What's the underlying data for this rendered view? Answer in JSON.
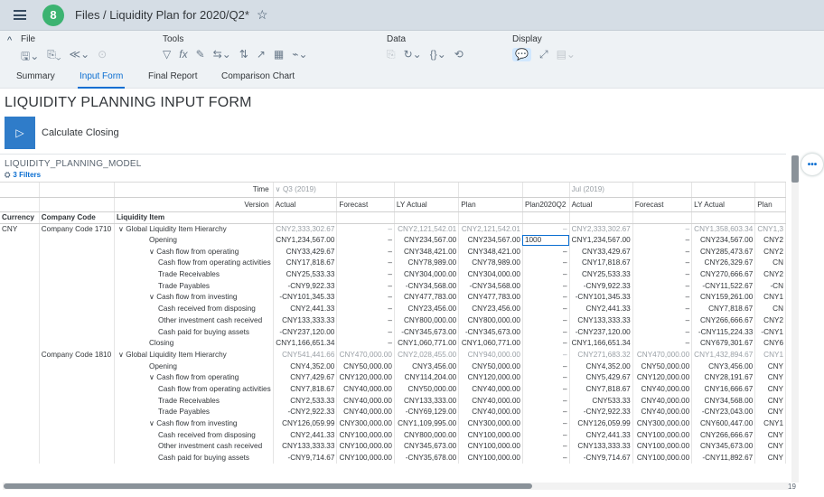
{
  "shell": {
    "logo_letter": "8",
    "breadcrumb": "Files / Liquidity Plan for 2020/Q2*"
  },
  "toolbar": {
    "file": "File",
    "tools": "Tools",
    "data": "Data",
    "display": "Display"
  },
  "tabs": [
    "Summary",
    "Input Form",
    "Final Report",
    "Comparison Chart"
  ],
  "page_title": "LIQUIDITY PLANNING INPUT FORM",
  "run_label": "Calculate Closing",
  "model_name": "LIQUIDITY_PLANNING_MODEL",
  "filters_label": "3 Filters",
  "grid": {
    "time_label": "Time",
    "version_label": "Version",
    "dim_headers": [
      "Currency",
      "Company Code",
      "Liquidity Item"
    ],
    "period1": "∨ Q3 (2019)",
    "period2": "Jul (2019)",
    "versions": [
      "Actual",
      "Forecast",
      "LY Actual",
      "Plan",
      "Plan2020Q2",
      "Actual",
      "Forecast",
      "LY Actual",
      "Plan"
    ],
    "rows": [
      {
        "cur": "CNY",
        "cc": "Company Code 1710",
        "item": "∨ Global Liquidity Item Hierarchy",
        "lvl": 0,
        "gray": true,
        "v": [
          "CNY2,333,302.67",
          "–",
          "CNY2,121,542.01",
          "CNY2,121,542.01",
          "–",
          "CNY2,333,302.67",
          "–",
          "CNY1,358,603.34",
          "CNY1,3"
        ]
      },
      {
        "cur": "",
        "cc": "",
        "item": "Opening",
        "lvl": 1,
        "v": [
          "CNY1,234,567.00",
          "–",
          "CNY234,567.00",
          "CNY234,567.00",
          "1000",
          "CNY1,234,567.00",
          "–",
          "CNY234,567.00",
          "CNY2"
        ]
      },
      {
        "cur": "",
        "cc": "",
        "item": "∨ Cash flow from operating",
        "lvl": 1,
        "v": [
          "CNY33,429.67",
          "–",
          "CNY348,421.00",
          "CNY348,421.00",
          "–",
          "CNY33,429.67",
          "–",
          "CNY285,473.67",
          "CNY2"
        ]
      },
      {
        "cur": "",
        "cc": "",
        "item": "Cash flow from operating activities",
        "lvl": 2,
        "v": [
          "CNY17,818.67",
          "–",
          "CNY78,989.00",
          "CNY78,989.00",
          "–",
          "CNY17,818.67",
          "–",
          "CNY26,329.67",
          "CN"
        ]
      },
      {
        "cur": "",
        "cc": "",
        "item": "Trade Receivables",
        "lvl": 2,
        "v": [
          "CNY25,533.33",
          "–",
          "CNY304,000.00",
          "CNY304,000.00",
          "–",
          "CNY25,533.33",
          "–",
          "CNY270,666.67",
          "CNY2"
        ]
      },
      {
        "cur": "",
        "cc": "",
        "item": "Trade Payables",
        "lvl": 2,
        "v": [
          "-CNY9,922.33",
          "–",
          "-CNY34,568.00",
          "-CNY34,568.00",
          "–",
          "-CNY9,922.33",
          "–",
          "-CNY11,522.67",
          "-CN"
        ]
      },
      {
        "cur": "",
        "cc": "",
        "item": "∨ Cash flow from investing",
        "lvl": 1,
        "v": [
          "-CNY101,345.33",
          "–",
          "CNY477,783.00",
          "CNY477,783.00",
          "–",
          "-CNY101,345.33",
          "–",
          "CNY159,261.00",
          "CNY1"
        ]
      },
      {
        "cur": "",
        "cc": "",
        "item": "Cash received from disposing",
        "lvl": 2,
        "v": [
          "CNY2,441.33",
          "–",
          "CNY23,456.00",
          "CNY23,456.00",
          "–",
          "CNY2,441.33",
          "–",
          "CNY7,818.67",
          "CN"
        ]
      },
      {
        "cur": "",
        "cc": "",
        "item": "Other investment cash received",
        "lvl": 2,
        "v": [
          "CNY133,333.33",
          "–",
          "CNY800,000.00",
          "CNY800,000.00",
          "–",
          "CNY133,333.33",
          "–",
          "CNY266,666.67",
          "CNY2"
        ]
      },
      {
        "cur": "",
        "cc": "",
        "item": "Cash paid for buying assets",
        "lvl": 2,
        "v": [
          "-CNY237,120.00",
          "–",
          "-CNY345,673.00",
          "-CNY345,673.00",
          "–",
          "-CNY237,120.00",
          "–",
          "-CNY115,224.33",
          "-CNY1"
        ]
      },
      {
        "cur": "",
        "cc": "",
        "item": "Closing",
        "lvl": 1,
        "v": [
          "CNY1,166,651.34",
          "–",
          "CNY1,060,771.00",
          "CNY1,060,771.00",
          "–",
          "CNY1,166,651.34",
          "–",
          "CNY679,301.67",
          "CNY6"
        ]
      },
      {
        "cur": "",
        "cc": "Company Code 1810",
        "item": "∨ Global Liquidity Item Hierarchy",
        "lvl": 0,
        "gray": true,
        "v": [
          "CNY541,441.66",
          "CNY470,000.00",
          "CNY2,028,455.00",
          "CNY940,000.00",
          "–",
          "CNY271,683.32",
          "CNY470,000.00",
          "CNY1,432,894.67",
          "CNY1"
        ]
      },
      {
        "cur": "",
        "cc": "",
        "item": "Opening",
        "lvl": 1,
        "v": [
          "CNY4,352.00",
          "CNY50,000.00",
          "CNY3,456.00",
          "CNY50,000.00",
          "–",
          "CNY4,352.00",
          "CNY50,000.00",
          "CNY3,456.00",
          "CNY"
        ]
      },
      {
        "cur": "",
        "cc": "",
        "item": "∨ Cash flow from operating",
        "lvl": 1,
        "v": [
          "CNY7,429.67",
          "CNY120,000.00",
          "CNY114,204.00",
          "CNY120,000.00",
          "–",
          "CNY5,429.67",
          "CNY120,000.00",
          "CNY28,191.67",
          "CNY"
        ]
      },
      {
        "cur": "",
        "cc": "",
        "item": "Cash flow from operating activities",
        "lvl": 2,
        "v": [
          "CNY7,818.67",
          "CNY40,000.00",
          "CNY50,000.00",
          "CNY40,000.00",
          "–",
          "CNY7,818.67",
          "CNY40,000.00",
          "CNY16,666.67",
          "CNY"
        ]
      },
      {
        "cur": "",
        "cc": "",
        "item": "Trade Receivables",
        "lvl": 2,
        "v": [
          "CNY2,533.33",
          "CNY40,000.00",
          "CNY133,333.00",
          "CNY40,000.00",
          "–",
          "CNY533.33",
          "CNY40,000.00",
          "CNY34,568.00",
          "CNY"
        ]
      },
      {
        "cur": "",
        "cc": "",
        "item": "Trade Payables",
        "lvl": 2,
        "v": [
          "-CNY2,922.33",
          "CNY40,000.00",
          "-CNY69,129.00",
          "CNY40,000.00",
          "–",
          "-CNY2,922.33",
          "CNY40,000.00",
          "-CNY23,043.00",
          "CNY"
        ]
      },
      {
        "cur": "",
        "cc": "",
        "item": "∨ Cash flow from investing",
        "lvl": 1,
        "v": [
          "CNY126,059.99",
          "CNY300,000.00",
          "CNY1,109,995.00",
          "CNY300,000.00",
          "–",
          "CNY126,059.99",
          "CNY300,000.00",
          "CNY600,447.00",
          "CNY1"
        ]
      },
      {
        "cur": "",
        "cc": "",
        "item": "Cash received from disposing",
        "lvl": 2,
        "v": [
          "CNY2,441.33",
          "CNY100,000.00",
          "CNY800,000.00",
          "CNY100,000.00",
          "–",
          "CNY2,441.33",
          "CNY100,000.00",
          "CNY266,666.67",
          "CNY"
        ]
      },
      {
        "cur": "",
        "cc": "",
        "item": "Other investment cash received",
        "lvl": 2,
        "v": [
          "CNY133,333.33",
          "CNY100,000.00",
          "CNY345,673.00",
          "CNY100,000.00",
          "–",
          "CNY133,333.33",
          "CNY100,000.00",
          "CNY345,673.00",
          "CNY"
        ]
      },
      {
        "cur": "",
        "cc": "",
        "item": "Cash paid for buying assets",
        "lvl": 2,
        "v": [
          "-CNY9,714.67",
          "CNY100,000.00",
          "-CNY35,678.00",
          "CNY100,000.00",
          "–",
          "-CNY9,714.67",
          "CNY100,000.00",
          "-CNY11,892.67",
          "CNY"
        ]
      }
    ]
  },
  "page_number": "19"
}
